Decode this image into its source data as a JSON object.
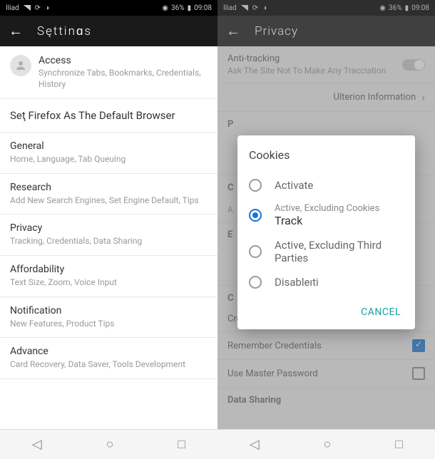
{
  "status": {
    "carrier": "Iliad",
    "battery": "36%",
    "time": "09:08",
    "eye_icon": "◉"
  },
  "left": {
    "app_title": "Sęttinɑs",
    "access": {
      "title": "Access",
      "sub": "Synchronize Tabs, Bookmarks, Credentials, History"
    },
    "default_browser": "Seţ Firefox As The Default Browser",
    "items": [
      {
        "title": "General",
        "sub": "Home, Language, Tab Queuing"
      },
      {
        "title": "Research",
        "sub": "Add New Search Engines, Set Engine Default, Tips"
      },
      {
        "title": "Privacy",
        "sub": "Tracking, Credentials, Data Sharing"
      },
      {
        "title": "Affordability",
        "sub": "Text Size, Zoom, Voice Input"
      },
      {
        "title": "Notification",
        "sub": "New Features, Product Tips"
      },
      {
        "title": "Advance",
        "sub": "Card Recovery, Data Saver, Tools Development"
      }
    ]
  },
  "right": {
    "app_title": "Privacy",
    "anti_tracking": {
      "title": "Anti-tracking",
      "sub": "Ask The Site Not To Make Any Tracciation"
    },
    "ulterion": "Ulterion Information",
    "credential_mgmt": "Credential Management",
    "remember_cred": "Remember Credentials",
    "master_pwd": "Use Master Password",
    "data_sharing": "Data Sharing",
    "sections": {
      "p": "P",
      "c": "C",
      "a": "A",
      "e": "E",
      "c2": "C"
    }
  },
  "dialog": {
    "title": "Cookies",
    "options": [
      {
        "label": "Activate",
        "selected": false
      },
      {
        "l1": "Active, Excluding Cookies",
        "l2": "Track",
        "selected": true,
        "two_line": true
      },
      {
        "label": "Active, Excluding Third Parties",
        "selected": false
      },
      {
        "label": "Disableıti",
        "selected": false
      }
    ],
    "cancel": "CANCEL"
  }
}
